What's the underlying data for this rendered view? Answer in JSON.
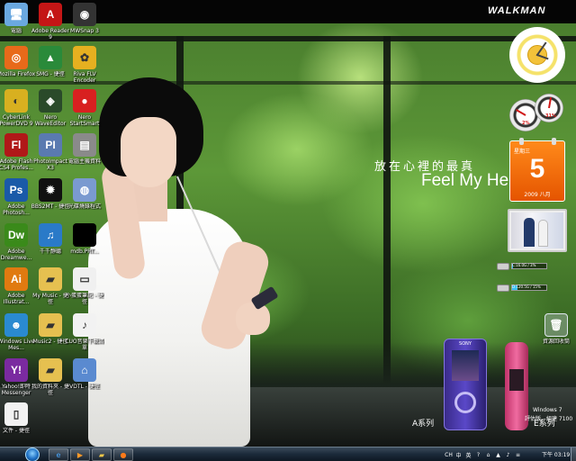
{
  "wallpaper": {
    "walkman_logo": "WALKMAN",
    "tagline_cn": "放在心裡的最真",
    "tagline_en": "Feel My He",
    "series_a": "A系列",
    "series_e": "E系列",
    "device_brand": "SONY",
    "os_name": "Windows 7",
    "os_build": "評估版。組建 7100"
  },
  "desktop_icons": [
    {
      "label": "電腦",
      "icon": "computer-icon",
      "color": "#6aa8e0"
    },
    {
      "label": "Adobe Reader 9",
      "icon": "pdf-icon",
      "color": "#c41616"
    },
    {
      "label": "MWSnap 3",
      "icon": "camera-icon",
      "color": "#333333"
    },
    {
      "label": "Mozilla Firefox",
      "icon": "firefox-icon",
      "color": "#e86a1a"
    },
    {
      "label": "SMG - 捷徑",
      "icon": "smg-icon",
      "color": "#2a8a3a"
    },
    {
      "label": "Riva FLV Encoder",
      "icon": "riva-icon",
      "color": "#e6b020"
    },
    {
      "label": "CyberLink PowerDVD 9",
      "icon": "dvd-icon",
      "color": "#d8b020"
    },
    {
      "label": "Nero WaveEditor",
      "icon": "nero-wave-icon",
      "color": "#2a4a2a"
    },
    {
      "label": "Nero StartSmart",
      "icon": "nero-start-icon",
      "color": "#d82020"
    },
    {
      "label": "Adobe Flash CS4 Profes...",
      "icon": "flash-icon",
      "color": "#b01818"
    },
    {
      "label": "PhotoImpact X3",
      "icon": "photoimpact-icon",
      "color": "#5a7ab0"
    },
    {
      "label": "電腦主機資料",
      "icon": "pc-info-icon",
      "color": "#8a8a8a"
    },
    {
      "label": "Adobe Photosh...",
      "icon": "photoshop-icon",
      "color": "#1a5aa8"
    },
    {
      "label": "BBS2MT - 捷徑",
      "icon": "bbs-icon",
      "color": "#111111"
    },
    {
      "label": "光碟燒錄程式",
      "icon": "disc-icon",
      "color": "#7a9ad0"
    },
    {
      "label": "Adobe Dreamwe...",
      "icon": "dreamweaver-icon",
      "color": "#3a8a1a"
    },
    {
      "label": "千千靜聽",
      "icon": "ttplayer-icon",
      "color": "#2a7ac8"
    },
    {
      "label": "mdb.PRT...",
      "icon": "black-file-icon",
      "color": "#000000"
    },
    {
      "label": "Adobe Illustrat...",
      "icon": "illustrator-icon",
      "color": "#e07a10"
    },
    {
      "label": "My Music - 捷徑",
      "icon": "music-folder-icon",
      "color": "#e6c050"
    },
    {
      "label": "小蛋蛋筆記 - 捷徑",
      "icon": "notes-icon",
      "color": "#f0f0f0"
    },
    {
      "label": "Windows Live Mes...",
      "icon": "messenger-icon",
      "color": "#2a8ad0"
    },
    {
      "label": "Music2 - 捷徑",
      "icon": "music2-folder-icon",
      "color": "#e6c050"
    },
    {
      "label": "CUO音樂下載清單",
      "icon": "mp3-icon",
      "color": "#f2f2f2"
    },
    {
      "label": "Yahoo!即時 Messenger",
      "icon": "yahoo-icon",
      "color": "#7a2aa0"
    },
    {
      "label": "我的資料夾 - 捷徑",
      "icon": "my-folder-icon",
      "color": "#e6c050"
    },
    {
      "label": "VDTL - 捷徑",
      "icon": "network-icon",
      "color": "#5a8ad0"
    },
    {
      "label": "文件 - 捷徑",
      "icon": "document-icon",
      "color": "#f2f2f2"
    }
  ],
  "recycle_bin": {
    "label": "資源回收筒",
    "icon": "recycle-bin-icon"
  },
  "gadgets": {
    "calendar": {
      "weekday": "星期三",
      "day": "5",
      "year_month": "2009 八月"
    },
    "cpu_meter": {
      "cpu_percent": "2%",
      "ram_percent": "31%"
    },
    "drives": [
      {
        "label": "C:16.0G / 3%",
        "fill": 0.03
      },
      {
        "label": "D:120.5G / 15%",
        "fill": 0.15
      }
    ]
  },
  "taskbar": {
    "time": "下午 03:19",
    "pinned": [
      {
        "name": "ie",
        "icon": "ie-icon"
      },
      {
        "name": "media-player",
        "icon": "media-player-icon"
      },
      {
        "name": "explorer",
        "icon": "explorer-folder-icon"
      },
      {
        "name": "firefox",
        "icon": "firefox-task-icon"
      },
      {
        "name": "smg",
        "icon": "smg-task-icon"
      }
    ],
    "tray": [
      "CH",
      "中",
      "英",
      "?",
      "⌂",
      "▲",
      "♪",
      "≡"
    ]
  },
  "colors": {
    "taskbar": "#1b2a3a",
    "calendar": "#f07010",
    "accent": "#35c0f0"
  }
}
